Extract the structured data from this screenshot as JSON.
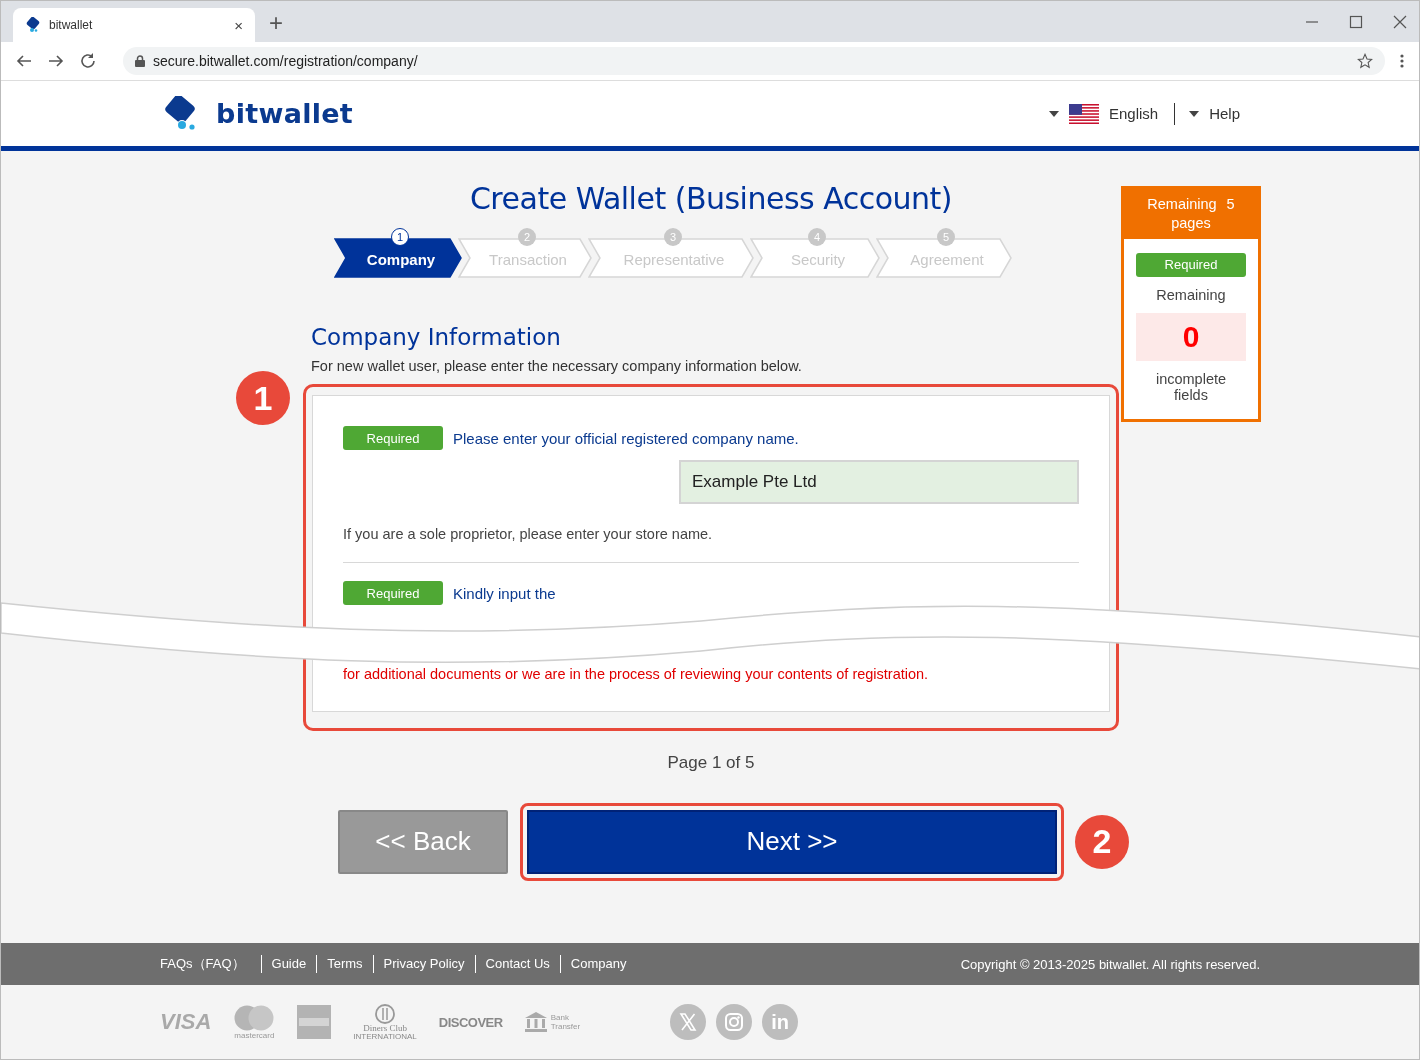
{
  "browser": {
    "tab_title": "bitwallet",
    "tab_close": "×",
    "new_tab": "+",
    "url": "secure.bitwallet.com/registration/company/"
  },
  "header": {
    "logo_text": "bitwallet",
    "language": "English",
    "help": "Help"
  },
  "title": "Create Wallet (Business Account)",
  "steps": [
    {
      "number": "1",
      "label": "Company",
      "selected": true
    },
    {
      "number": "2",
      "label": "Transaction",
      "selected": false
    },
    {
      "number": "3",
      "label": "Representative",
      "selected": false
    },
    {
      "number": "4",
      "label": "Security",
      "selected": false
    },
    {
      "number": "5",
      "label": "Agreement",
      "selected": false
    }
  ],
  "progress_panel": {
    "heading": "Remaining 5 pages",
    "badge": "Required",
    "label": "Remaining",
    "count": "0",
    "caption": "incomplete fields"
  },
  "section": {
    "title": "Company Information",
    "intro": "For new wallet user, please enter the necessary company information below.",
    "fields": [
      {
        "badge": "Required",
        "label": "Please enter your official registered company name.",
        "value": "Example Pte Ltd",
        "note": "If you are a sole proprietor, please enter your store name."
      },
      {
        "badge": "Required",
        "label": "Kindly input the"
      }
    ],
    "notice": "for additional documents or we are in the process of reviewing your contents of registration."
  },
  "pager": "Page 1 of 5",
  "buttons": {
    "back": "<< Back",
    "next": "Next >>"
  },
  "annotations": [
    {
      "number": "1"
    },
    {
      "number": "2"
    }
  ],
  "footer": {
    "links": [
      "FAQs（FAQ）",
      "Guide",
      "Terms",
      "Privacy Policy",
      "Contact Us",
      "Company"
    ],
    "copyright": "Copyright © 2013-2025 bitwallet. All rights reserved."
  },
  "payment_logos": [
    {
      "kind": "visa",
      "text": "VISA"
    },
    {
      "kind": "mastercard",
      "text": "mastercard"
    },
    {
      "kind": "amex"
    },
    {
      "kind": "diners",
      "text": "Diners Club",
      "subtext": "INTERNATIONAL"
    },
    {
      "kind": "discover",
      "text": "DISCOVER"
    },
    {
      "kind": "bank",
      "text": "Bank",
      "subtext": "Transfer"
    }
  ],
  "social": [
    {
      "kind": "x"
    },
    {
      "kind": "camera"
    },
    {
      "kind": "in",
      "text": "in"
    }
  ]
}
